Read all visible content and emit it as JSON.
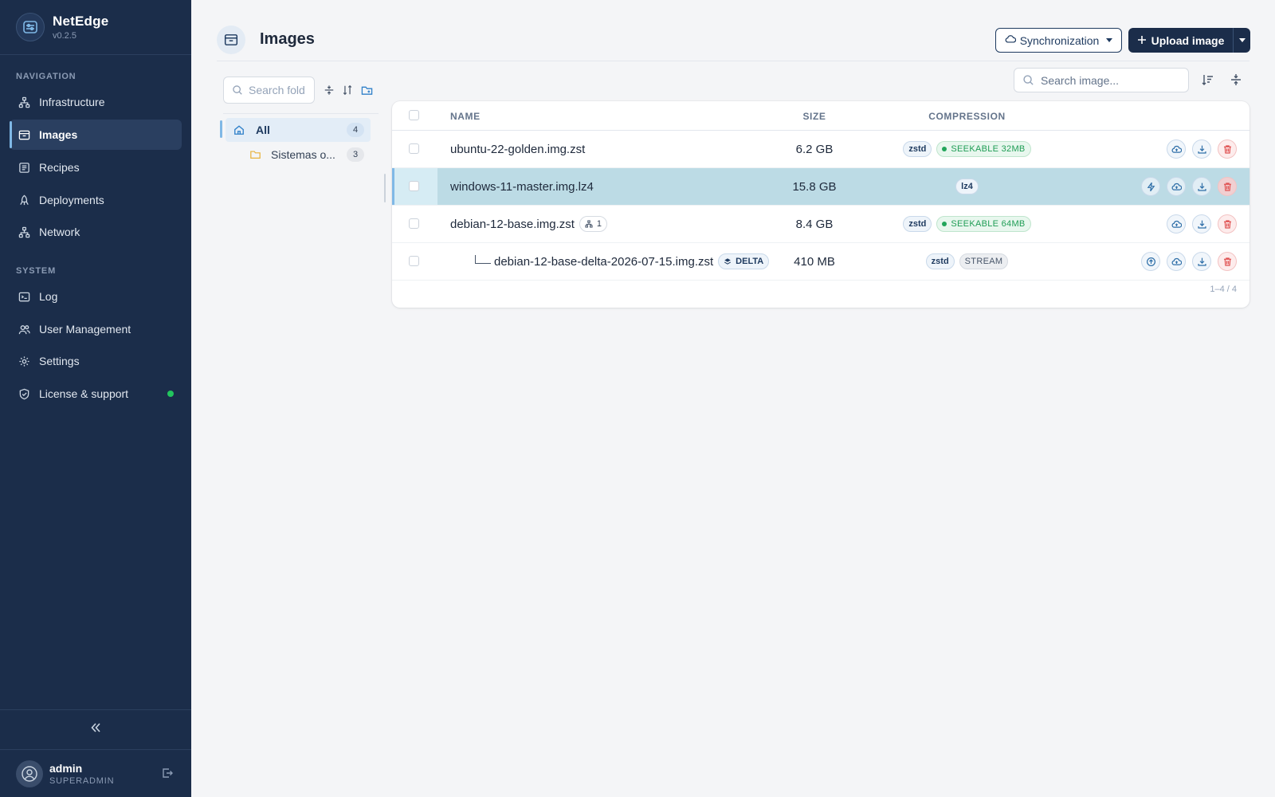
{
  "app": {
    "name": "NetEdge",
    "version": "v0.2.5"
  },
  "sidebar": {
    "navigation_title": "NAVIGATION",
    "navigation": [
      {
        "label": "Infrastructure",
        "icon": "network-nodes-icon",
        "active": false
      },
      {
        "label": "Images",
        "icon": "archive-box-icon",
        "active": true
      },
      {
        "label": "Recipes",
        "icon": "book-icon",
        "active": false
      },
      {
        "label": "Deployments",
        "icon": "rocket-icon",
        "active": false
      },
      {
        "label": "Network",
        "icon": "network-icon",
        "active": false
      }
    ],
    "system_title": "SYSTEM",
    "system": [
      {
        "label": "Log",
        "icon": "terminal-icon"
      },
      {
        "label": "User Management",
        "icon": "users-icon"
      },
      {
        "label": "Settings",
        "icon": "gear-icon"
      },
      {
        "label": "License & support",
        "icon": "shield-check-icon",
        "status_color": "#22c55e"
      }
    ],
    "user": {
      "name": "admin",
      "role": "SUPERADMIN"
    }
  },
  "header": {
    "title": "Images",
    "sync_label": "Synchronization",
    "upload_label": "Upload image"
  },
  "folders": {
    "search_placeholder": "Search fold",
    "items": [
      {
        "label": "All",
        "count": "4",
        "icon": "home-icon",
        "active": true
      },
      {
        "label": "Sistemas o...",
        "count": "3",
        "icon": "folder-icon",
        "active": false
      }
    ]
  },
  "images": {
    "search_placeholder": "Search image...",
    "columns": {
      "name": "NAME",
      "size": "SIZE",
      "compression": "COMPRESSION"
    },
    "rows": [
      {
        "name": "ubuntu-22-golden.img.zst",
        "size": "6.2 GB",
        "algo": "zstd",
        "mode": "SEEKABLE 32MB",
        "mode_kind": "seekable",
        "selected": false
      },
      {
        "name": "windows-11-master.img.lz4",
        "size": "15.8 GB",
        "algo": "lz4",
        "mode": "",
        "mode_kind": "none",
        "selected": true
      },
      {
        "name": "debian-12-base.img.zst",
        "size": "8.4 GB",
        "algo": "zstd",
        "mode": "SEEKABLE 64MB",
        "mode_kind": "seekable",
        "children": "1",
        "selected": false
      },
      {
        "name": "debian-12-base-delta-2026-07-15.img.zst",
        "size": "410 MB",
        "algo": "zstd",
        "mode": "STREAM",
        "mode_kind": "stream",
        "tag": "DELTA",
        "selected": false
      }
    ],
    "pagination": "1–4 / 4"
  },
  "colors": {
    "sidebar_bg": "#1b2d4a",
    "accent": "#7fb8e6",
    "selected_row": "#bcdbe5",
    "success": "#22a55a",
    "danger": "#e05252"
  }
}
